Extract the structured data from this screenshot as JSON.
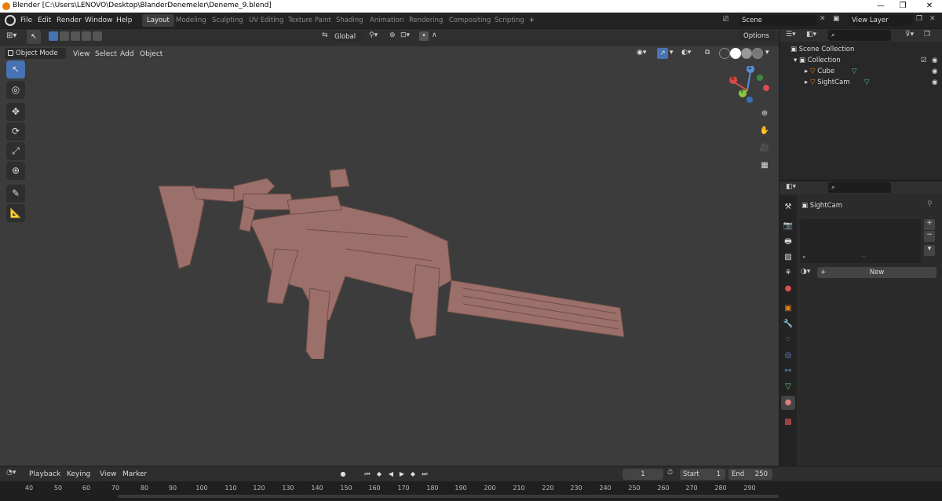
{
  "window": {
    "title": "Blender [C:\\Users\\LENOVO\\Desktop\\BlanderDenemeler\\Deneme_9.blend]",
    "min": "—",
    "max": "❐",
    "close": "✕"
  },
  "menu": [
    "File",
    "Edit",
    "Render",
    "Window",
    "Help"
  ],
  "workspaces": [
    "Layout",
    "Modeling",
    "Sculpting",
    "UV Editing",
    "Texture Paint",
    "Shading",
    "Animation",
    "Rendering",
    "Compositing",
    "Scripting"
  ],
  "add_workspace": "+",
  "scene": {
    "name": "Scene",
    "view_layer": "View Layer"
  },
  "viewport": {
    "mode": "Object Mode",
    "menus": [
      "View",
      "Select",
      "Add",
      "Object"
    ],
    "transform_orientation": "Global",
    "options_label": "Options",
    "model_color": "#9c706a",
    "gizmo": {
      "x": "X",
      "y": "Y",
      "z": "Z"
    }
  },
  "tools": [
    "select-box-icon",
    "cursor-icon",
    "move-icon",
    "rotate-icon",
    "scale-icon",
    "transform-icon",
    "annotate-icon",
    "measure-icon"
  ],
  "outliner": {
    "root": "Scene Collection",
    "collection": "Collection",
    "items": [
      {
        "name": "Cube"
      },
      {
        "name": "SightCam"
      }
    ]
  },
  "properties": {
    "object_name": "SightCam",
    "new_label": "New",
    "plus": "+",
    "minus": "−"
  },
  "timeline": {
    "menus": [
      "Playback",
      "Keying",
      "View",
      "Marker"
    ],
    "current_frame": "1",
    "start_label": "Start",
    "start": "1",
    "end_label": "End",
    "end": "250",
    "ticks": [
      "40",
      "50",
      "60",
      "70",
      "80",
      "90",
      "100",
      "110",
      "120",
      "130",
      "140",
      "150",
      "160",
      "170",
      "180",
      "190",
      "200",
      "210",
      "220",
      "230",
      "240",
      "250",
      "260",
      "270",
      "280",
      "290"
    ]
  },
  "colors": {
    "accent": "#4772b3",
    "active_tab": "#3d3d3d",
    "viewport_bg": "#3c3c3c"
  }
}
